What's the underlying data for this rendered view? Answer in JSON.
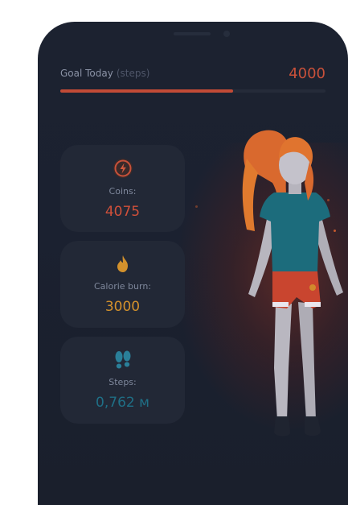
{
  "goal": {
    "label": "Goal Today",
    "unit": "(steps)",
    "value": "4000",
    "progress": 0.65
  },
  "cards": [
    {
      "label": "Coins:",
      "value": "4075",
      "icon": "coin-icon",
      "color": "#d0503a"
    },
    {
      "label": "Calorie burn:",
      "value": "3000",
      "icon": "flame-icon",
      "color": "#d3912c"
    },
    {
      "label": "Steps:",
      "value": "0,762 м",
      "icon": "footprints-icon",
      "color": "#1f6f86"
    }
  ],
  "colors": {
    "background": "#1b2130",
    "accent": "#c9513a",
    "card": "#222836"
  }
}
